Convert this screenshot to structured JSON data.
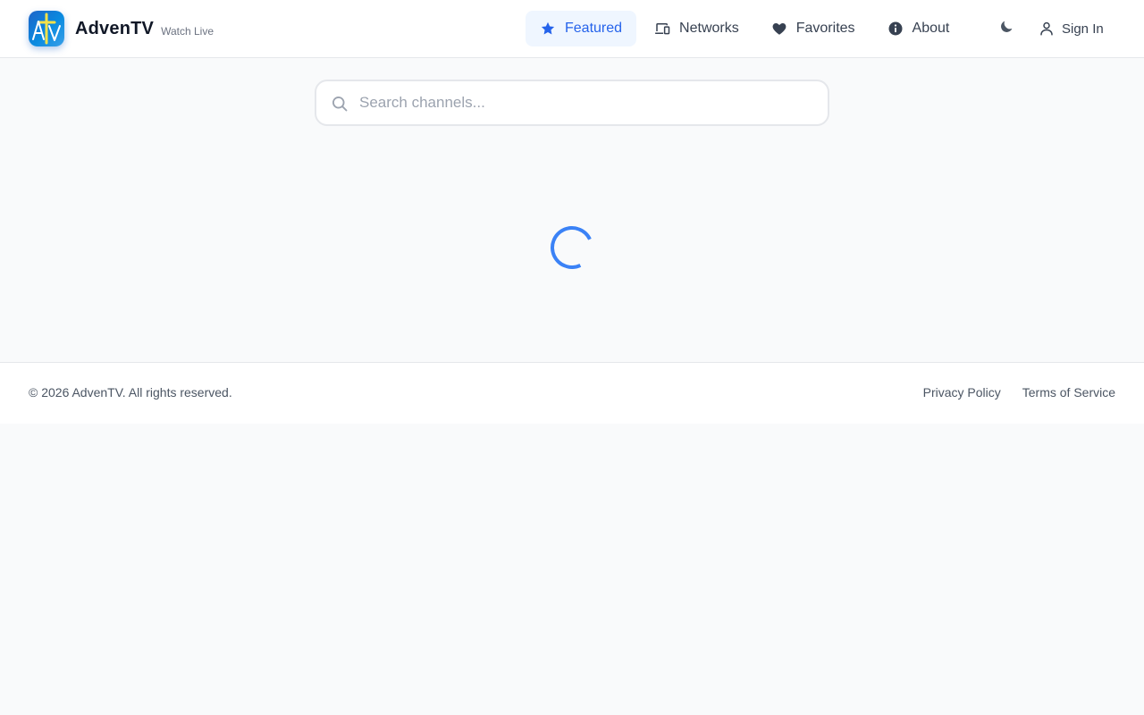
{
  "header": {
    "brand": {
      "name": "AdvenTV",
      "tagline": "Watch Live",
      "logo_icon": "aTV-cross-logo-icon"
    },
    "nav": [
      {
        "label": "Featured",
        "icon": "star-icon",
        "active": true
      },
      {
        "label": "Networks",
        "icon": "devices-icon",
        "active": false
      },
      {
        "label": "Favorites",
        "icon": "heart-icon",
        "active": false
      },
      {
        "label": "About",
        "icon": "info-icon",
        "active": false
      }
    ],
    "theme_toggle_icon": "moon-icon",
    "sign_in": {
      "label": "Sign In",
      "icon": "user-icon"
    }
  },
  "search": {
    "placeholder": "Search channels...",
    "value": "",
    "icon": "search-icon"
  },
  "loading": {
    "icon": "spinner-icon"
  },
  "footer": {
    "copyright": "© 2026 AdvenTV. All rights reserved.",
    "links": [
      {
        "label": "Privacy Policy"
      },
      {
        "label": "Terms of Service"
      }
    ]
  },
  "colors": {
    "accent": "#2563eb",
    "accent_bg": "#eff6ff",
    "page_bg": "#f9fafb",
    "border": "#e5e7eb",
    "spinner": "#3b82f6"
  }
}
